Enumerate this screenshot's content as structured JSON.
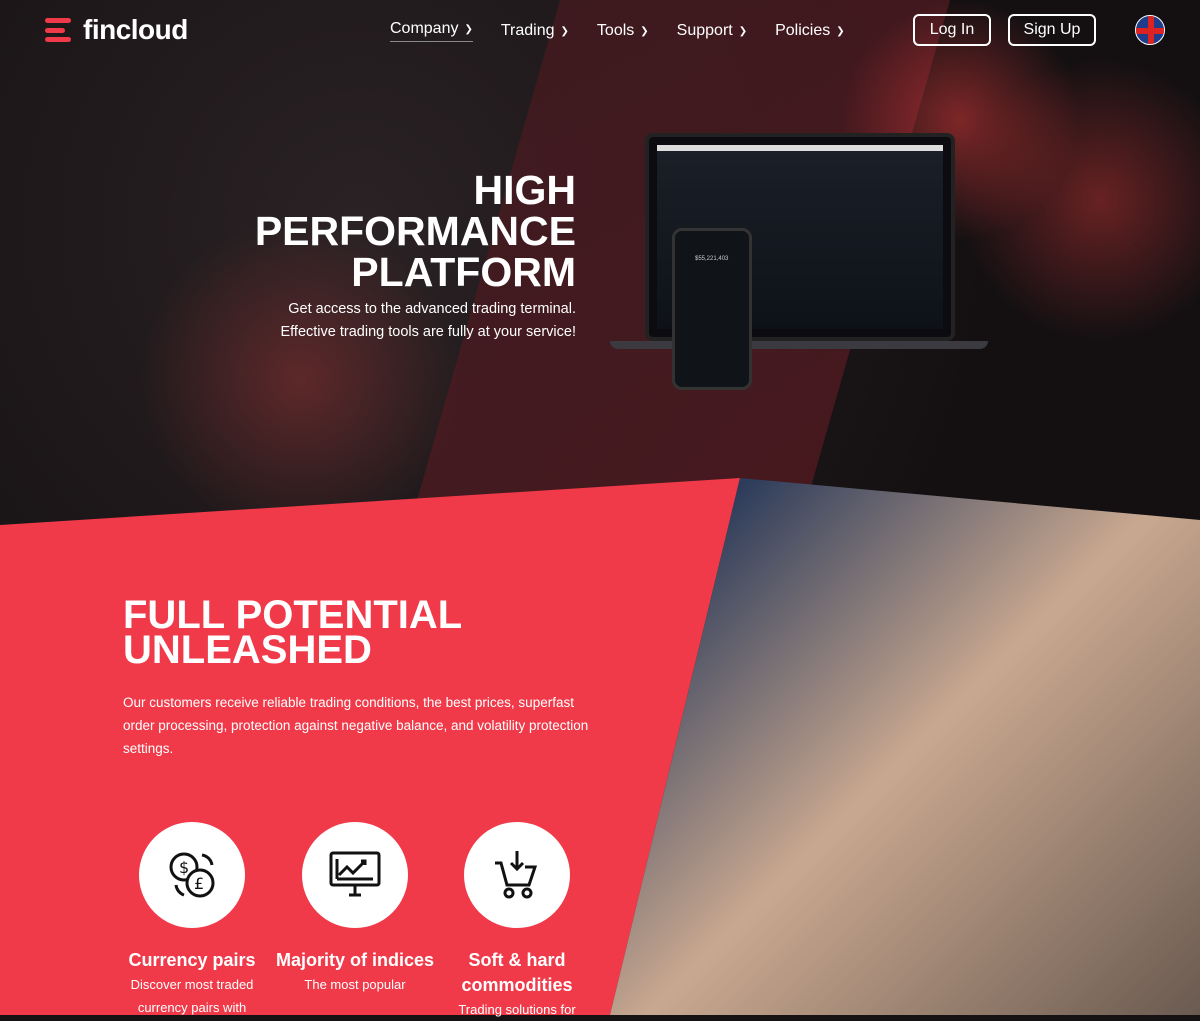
{
  "header": {
    "logo": "fincloud",
    "nav": [
      {
        "label": "Company",
        "active": true
      },
      {
        "label": "Trading"
      },
      {
        "label": "Tools"
      },
      {
        "label": "Support"
      },
      {
        "label": "Policies"
      }
    ],
    "login": "Log In",
    "signup": "Sign Up",
    "language_icon": "uk-flag-icon"
  },
  "hero": {
    "title_lines": [
      "HIGH",
      "PERFORMANCE",
      "PLATFORM"
    ],
    "subtitle_lines": [
      "Get access to the advanced trading terminal.",
      "Effective trading tools are fully at your service!"
    ],
    "phone_balance": "$55,221,403"
  },
  "section": {
    "title_lines": [
      "FULL POTENTIAL",
      "UNLEASHED"
    ],
    "text": "Our customers receive reliable trading conditions, the best prices, superfast order processing, protection against negative balance, and volatility protection settings.",
    "features": [
      {
        "icon": "currency-exchange-icon",
        "title": "Currency pairs",
        "desc": "Discover most traded currency pairs with"
      },
      {
        "icon": "monitor-chart-icon",
        "title": "Majority of indices",
        "desc": "The most popular"
      },
      {
        "icon": "cart-download-icon",
        "title": "Soft & hard commodities",
        "desc": "Trading solutions for"
      }
    ]
  },
  "colors": {
    "accent": "#f03a4a",
    "dark": "#161214"
  }
}
